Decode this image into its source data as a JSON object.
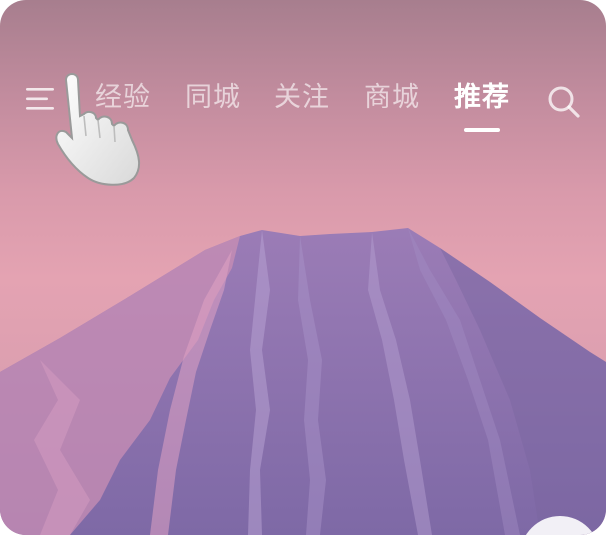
{
  "header": {
    "tabs": [
      {
        "label": "经验",
        "active": false
      },
      {
        "label": "同城",
        "active": false
      },
      {
        "label": "关注",
        "active": false
      },
      {
        "label": "商城",
        "active": false
      },
      {
        "label": "推荐",
        "active": true
      }
    ],
    "menu_icon": "menu-icon",
    "search_icon": "search-icon"
  },
  "overlay": {
    "gesture_icon": "tap-hand-icon"
  },
  "background": {
    "sky_top": "#a77e8e",
    "sky_mid": "#e4a3b2",
    "mountain": "#8a6fa8"
  }
}
